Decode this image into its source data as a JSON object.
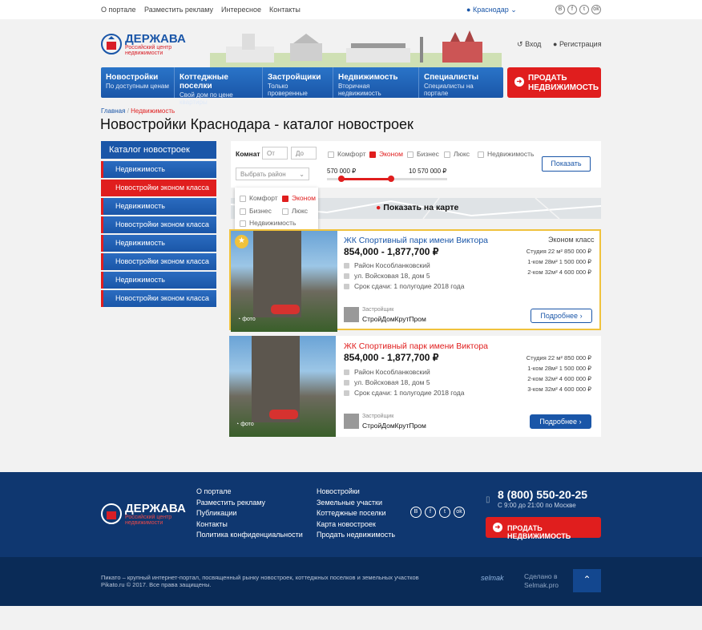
{
  "top": {
    "links": [
      "О портале",
      "Разместить рекламу",
      "Интересное",
      "Контакты"
    ],
    "city": "Краснодар",
    "socials": [
      "B",
      "f",
      "t",
      "ok"
    ]
  },
  "logo": {
    "title": "ДЕРЖАВА",
    "sub1": "Российский центр",
    "sub2": "недвижимости"
  },
  "auth": {
    "login": "Вход",
    "register": "Регистрация"
  },
  "nav": [
    {
      "t": "Новостройки",
      "s": "По доступным ценам"
    },
    {
      "t": "Коттеджные поселки",
      "s": "Свой дом по цене квартиры"
    },
    {
      "t": "Застройщики",
      "s": "Только проверенные"
    },
    {
      "t": "Недвижимость",
      "s": "Вторичная недвижимость"
    },
    {
      "t": "Специалисты",
      "s": "Специалисты на портале"
    }
  ],
  "sell": {
    "line1": "ПРОДАТЬ",
    "line2": "НЕДВИЖИМОСТЬ"
  },
  "breadcrumb": {
    "home": "Главная",
    "sep": "/",
    "current": "Недвижимость"
  },
  "page_title": "Новостройки Краснодара - каталог новостроек",
  "catalog": {
    "title": "Каталог новостроек",
    "items": [
      "Недвижимость",
      "Новостройки эконом класса",
      "Недвижимость",
      "Новостройки эконом класса",
      "Недвижимость",
      "Новостройки эконом класса",
      "Недвижимость",
      "Новостройки эконом класса"
    ],
    "active_index": 1
  },
  "filter": {
    "rooms_label": "Комнат",
    "from_ph": "От",
    "to_ph": "До",
    "district_ph": "Выбрать район",
    "classes": [
      "Комфорт",
      "Эконом",
      "Бизнес",
      "Люкс",
      "Недвижимость"
    ],
    "checked": "Эконом",
    "price_min": "570 000 ₽",
    "price_max": "10 570 000 ₽",
    "show": "Показать"
  },
  "dropdown": {
    "items": [
      "Комфорт",
      "Эконом",
      "Бизнес",
      "Люкс",
      "Недвижимость"
    ],
    "checked": "Эконом"
  },
  "map": {
    "label": "Показать на карте"
  },
  "cards": [
    {
      "title": "ЖК Спортивный парк имени Виктора",
      "price": "854,000 - 1,877,700 ₽",
      "district": "Район Кособланковский",
      "address": "ул. Войсковая 18, дом 5",
      "deadline": "Срок сдачи: 1 полугодие 2018 года",
      "class": "Эконом класс",
      "rooms": [
        "Студия 22 м² 850 000 ₽",
        "1-ком 28м² 1 500 000 ₽",
        "2-ком 32м² 4 600 000 ₽"
      ],
      "dev_label": "Застройщик",
      "dev": "СтройДомКрутПром",
      "more": "Подробнее",
      "photo": "фото",
      "highlight": true
    },
    {
      "title": "ЖК Спортивный парк имени Виктора",
      "price": "854,000 - 1,877,700 ₽",
      "district": "Район Кособланковский",
      "address": "ул. Войсковая 18, дом 5",
      "deadline": "Срок сдачи: 1 полугодие 2018 года",
      "class": "",
      "rooms": [
        "Студия 22 м² 850 000 ₽",
        "1-ком 28м² 1 500 000 ₽",
        "2-ком 32м² 4 600 000 ₽",
        "3-ком 32м² 4 600 000 ₽"
      ],
      "dev_label": "Застройщик",
      "dev": "СтройДомКрутПром",
      "more": "Подробнее",
      "photo": "фото",
      "highlight": false
    }
  ],
  "footer": {
    "col1": [
      "О портале",
      "Разместить рекламу",
      "Публикации",
      "Контакты",
      "Политика конфиденциальности"
    ],
    "col2": [
      "Новостройки",
      "Земельные участки",
      "Коттеджные поселки",
      "Карта новостроек",
      "Продать недвижимость"
    ],
    "phone": "8 (800) 550-20-25",
    "hours": "С 9:00 до 21:00 по Москве",
    "sell": "ПРОДАТЬ НЕДВИЖИМОСТЬ",
    "copy1": "Пикато – крупный интернет-портал, посвященный рынку  новостроек, коттеджных поселков и земельных участков",
    "copy2": "Pikato.ru © 2017. Все права защищены.",
    "made1": "Сделано в",
    "made2": "Selmak.pro",
    "selmak": "selmak"
  },
  "colors": {
    "blue": "#1a56a8",
    "red": "#e01e1e",
    "footer": "#0f3770"
  }
}
